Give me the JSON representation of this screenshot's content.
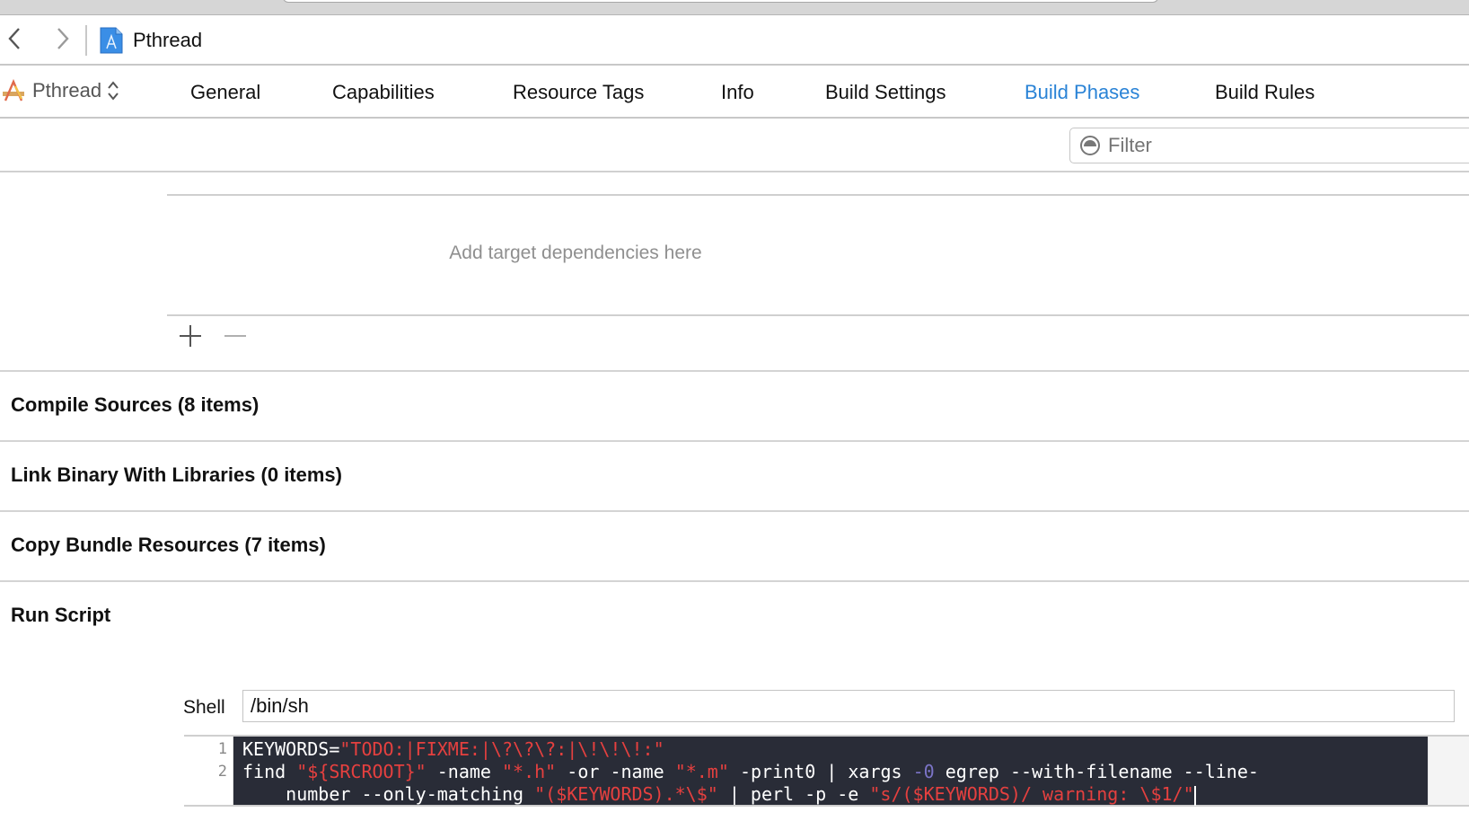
{
  "window": {
    "jump_bar": {
      "back_icon": "chevron-left-icon",
      "forward_icon": "chevron-right-icon",
      "project_icon": "xcode-project-file-icon",
      "title": "Pthread"
    }
  },
  "editor_tabs": {
    "target": {
      "icon": "app-target-icon",
      "name": "Pthread",
      "selector_icon": "up-down-chevron-icon"
    },
    "tabs": [
      {
        "label": "General",
        "active": false
      },
      {
        "label": "Capabilities",
        "active": false
      },
      {
        "label": "Resource Tags",
        "active": false
      },
      {
        "label": "Info",
        "active": false
      },
      {
        "label": "Build Settings",
        "active": false
      },
      {
        "label": "Build Phases",
        "active": true
      },
      {
        "label": "Build Rules",
        "active": false
      }
    ],
    "active_color": "#2a83d6"
  },
  "filter": {
    "placeholder": "Filter",
    "value": ""
  },
  "target_dependencies": {
    "placeholder": "Add target dependencies here",
    "add_label": "+",
    "remove_label": "−"
  },
  "phases": [
    {
      "title": "Compile Sources (8 items)"
    },
    {
      "title": "Link Binary With Libraries (0 items)"
    },
    {
      "title": "Copy Bundle Resources (7 items)"
    }
  ],
  "run_script": {
    "title": "Run Script",
    "shell_label": "Shell",
    "shell_value": "/bin/sh",
    "line_numbers": [
      "1",
      "2",
      ""
    ],
    "code": {
      "l1_a": "KEYWORDS=",
      "l1_b": "\"TODO:|FIXME:|\\?\\?\\?:|\\!\\!\\!:\"",
      "l2_a": "find ",
      "l2_b": "\"${SRCROOT}\"",
      "l2_c": " -name ",
      "l2_d": "\"*.h\"",
      "l2_e": " -or -name ",
      "l2_f": "\"*.m\"",
      "l2_g": " -print0 | xargs ",
      "l2_h": "-0",
      "l2_i": " egrep --with-filename --line-",
      "l3_a": "    number --only-matching ",
      "l3_b": "\"($KEYWORDS).*\\$\"",
      "l3_c": " | perl -p -e ",
      "l3_d": "\"s/($KEYWORDS)/ warning: \\$1/\""
    },
    "colors": {
      "background": "#292c37",
      "string": "#e5403f",
      "number": "#7b74c7",
      "text": "#ffffff"
    }
  }
}
